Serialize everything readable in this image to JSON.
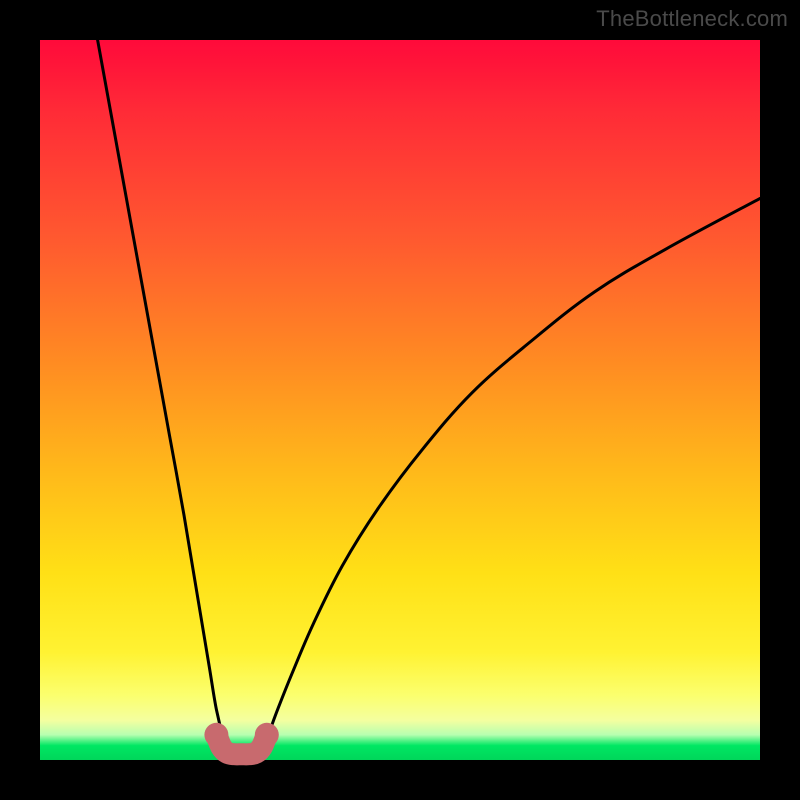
{
  "watermark": "TheBottleneck.com",
  "chart_data": {
    "type": "line",
    "title": "",
    "xlabel": "",
    "ylabel": "",
    "xlim": [
      0,
      100
    ],
    "ylim": [
      0,
      100
    ],
    "series": [
      {
        "name": "left-branch",
        "x": [
          8,
          10,
          12,
          14,
          16,
          18,
          20,
          22,
          23.5,
          24.5,
          25.5,
          26.3
        ],
        "values": [
          100,
          89,
          78,
          67,
          56,
          45,
          34,
          22,
          13,
          7,
          3,
          1
        ]
      },
      {
        "name": "right-branch",
        "x": [
          30.5,
          31.5,
          33,
          35,
          38,
          42,
          47,
          53,
          60,
          68,
          77,
          87,
          100
        ],
        "values": [
          1,
          3,
          7,
          12,
          19,
          27,
          35,
          43,
          51,
          58,
          65,
          71,
          78
        ]
      },
      {
        "name": "trough-marker",
        "x": [
          24.5,
          25.2,
          26.0,
          27.0,
          28.0,
          29.0,
          30.0,
          30.8,
          31.5
        ],
        "values": [
          3.5,
          1.8,
          1.0,
          0.8,
          0.8,
          0.8,
          1.0,
          1.8,
          3.5
        ]
      }
    ],
    "marker_color": "#c86a6e",
    "curve_color": "#000000"
  }
}
